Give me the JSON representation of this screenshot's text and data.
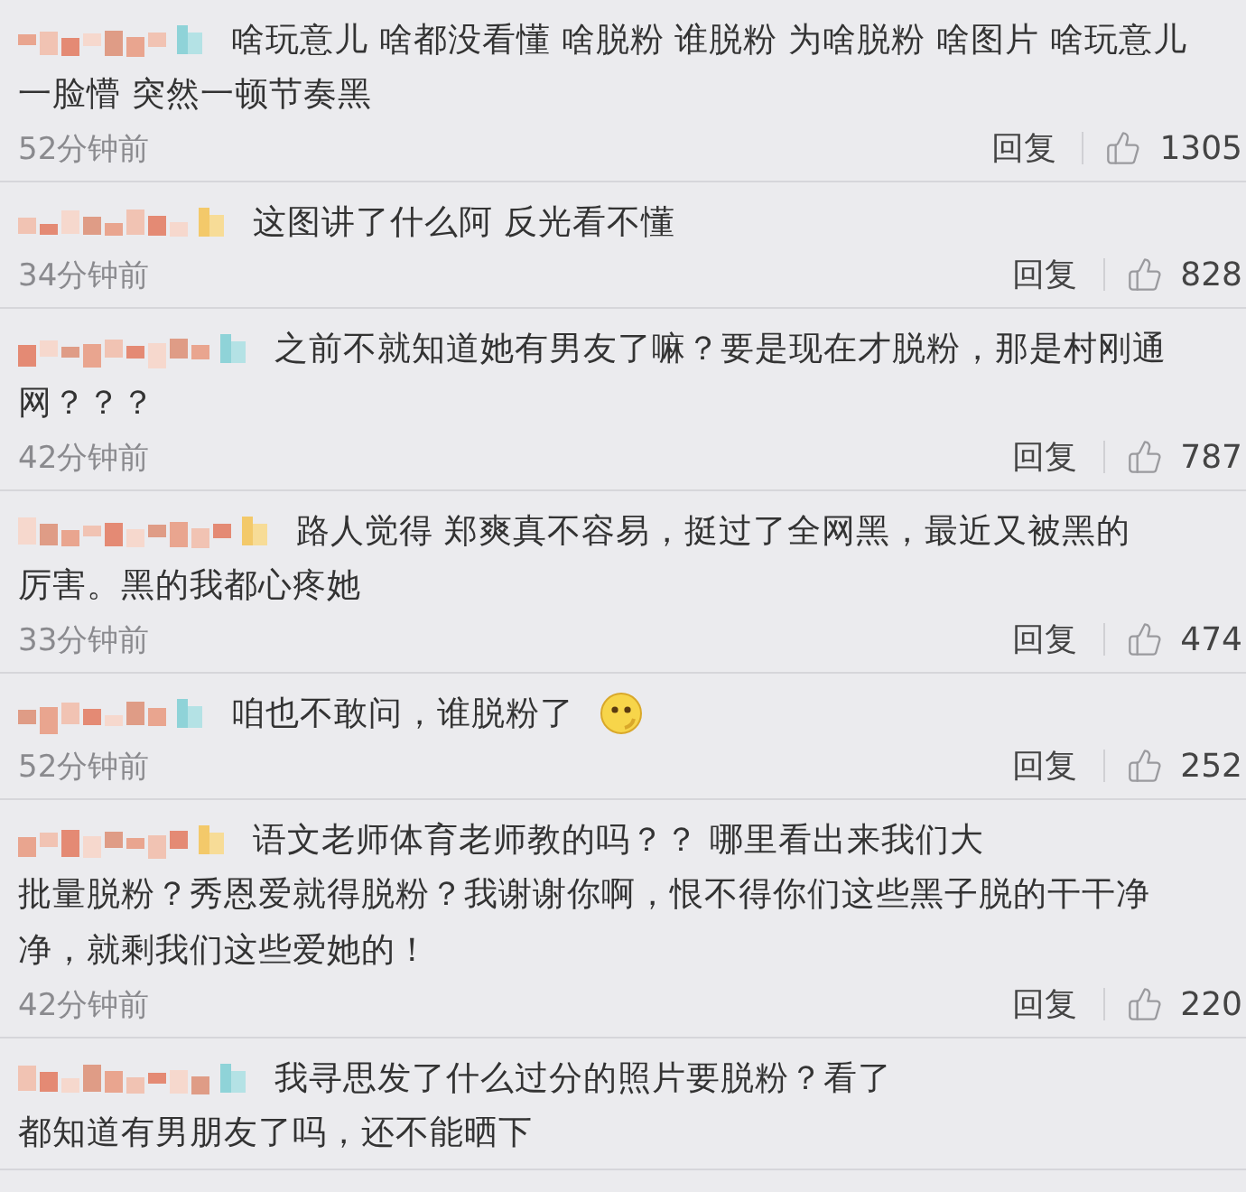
{
  "comments": [
    {
      "lines": [
        "啥玩意儿 啥都没看懂 啥脱粉 谁脱粉 为啥脱粉 啥图片 啥玩意儿",
        "一脸懵 突然一顿节奏黑"
      ],
      "emoji": false,
      "time": "52分钟前",
      "reply": "回复",
      "likes": "1305"
    },
    {
      "lines": [
        "这图讲了什么阿 反光看不懂"
      ],
      "emoji": false,
      "time": "34分钟前",
      "reply": "回复",
      "likes": "828"
    },
    {
      "lines": [
        "之前不就知道她有男友了嘛？要是现在才脱粉，那是村刚通",
        "网？？？"
      ],
      "emoji": false,
      "time": "42分钟前",
      "reply": "回复",
      "likes": "787"
    },
    {
      "lines": [
        "路人觉得 郑爽真不容易，挺过了全网黑，最近又被黑的",
        "厉害。黑的我都心疼她"
      ],
      "emoji": false,
      "time": "33分钟前",
      "reply": "回复",
      "likes": "474"
    },
    {
      "lines": [
        "咱也不敢问，谁脱粉了"
      ],
      "emoji": true,
      "time": "52分钟前",
      "reply": "回复",
      "likes": "252"
    },
    {
      "lines": [
        "语文老师体育老师教的吗？？ 哪里看出来我们大",
        "批量脱粉？秀恩爱就得脱粉？我谢谢你啊，恨不得你们这些黑子脱的干干净",
        "净，就剩我们这些爱她的！"
      ],
      "emoji": false,
      "time": "42分钟前",
      "reply": "回复",
      "likes": "220"
    },
    {
      "lines": [
        "我寻思发了什么过分的照片要脱粉？看了",
        "都知道有男朋友了吗，还不能晒下"
      ],
      "emoji": false
    }
  ]
}
